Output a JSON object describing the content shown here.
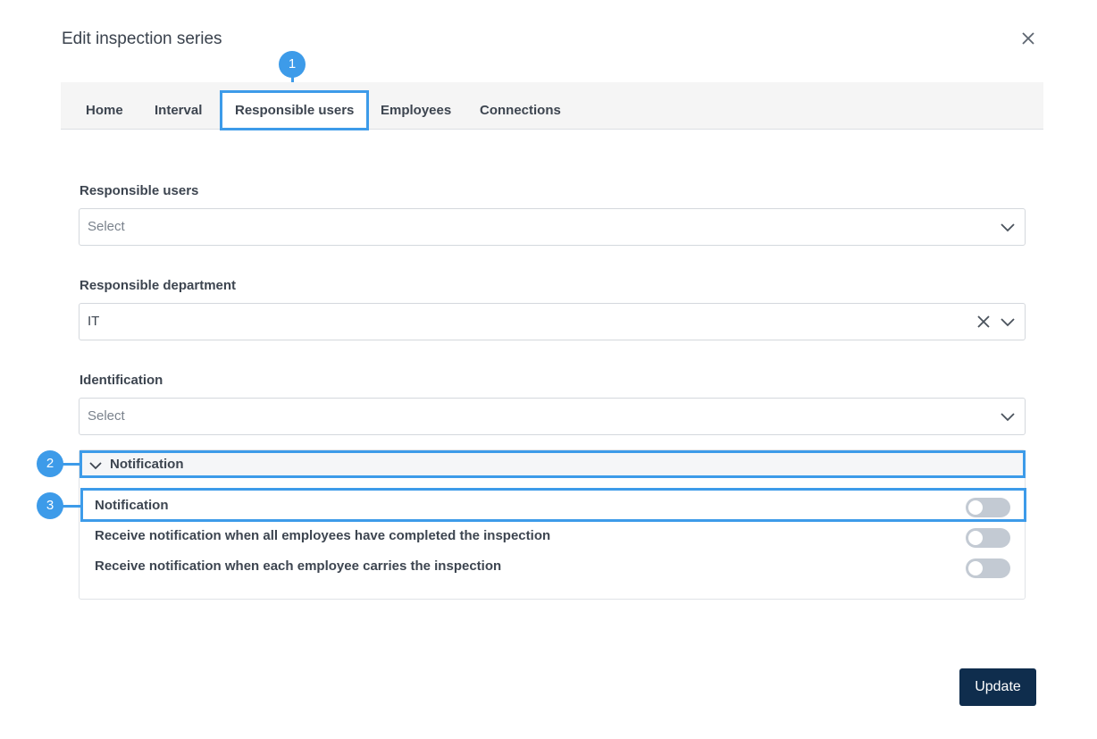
{
  "dialog": {
    "title": "Edit inspection series"
  },
  "tabs": [
    {
      "label": "Home"
    },
    {
      "label": "Interval"
    },
    {
      "label": "Responsible users",
      "active": true
    },
    {
      "label": "Employees"
    },
    {
      "label": "Connections"
    }
  ],
  "markers": [
    "1",
    "2",
    "3"
  ],
  "fields": {
    "responsible_users": {
      "label": "Responsible users",
      "placeholder": "Select"
    },
    "responsible_department": {
      "label": "Responsible department",
      "value": "IT"
    },
    "identification": {
      "label": "Identification",
      "placeholder": "Select"
    }
  },
  "notification": {
    "section_label": "Notification",
    "rows": [
      {
        "label": "Notification",
        "enabled": false
      },
      {
        "label": "Receive notification when all employees have completed the inspection",
        "enabled": false
      },
      {
        "label": "Receive notification when each employee carries the inspection",
        "enabled": false
      }
    ]
  },
  "footer": {
    "update_label": "Update"
  },
  "colors": {
    "accent": "#3d9be9",
    "primary_button": "#0f2d4d",
    "toggle_off": "#c3cad3"
  },
  "icons": {
    "close": "close-icon",
    "dropdown": "chevron-down-icon",
    "clear": "clear-icon"
  }
}
